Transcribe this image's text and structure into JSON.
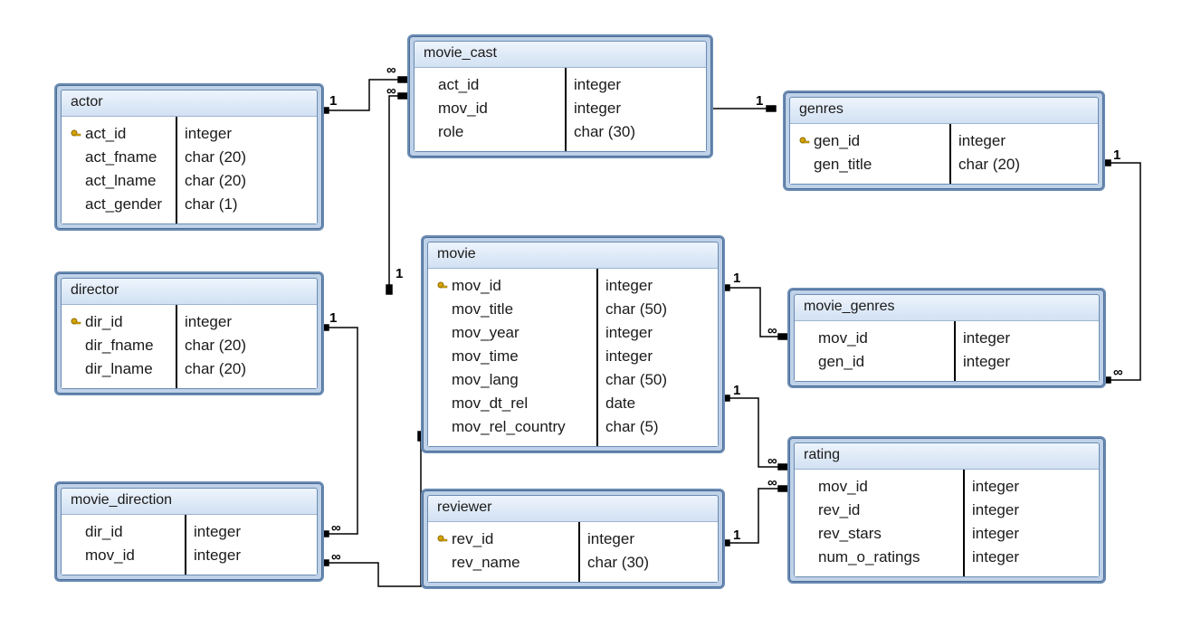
{
  "tables": {
    "actor": {
      "title": "actor",
      "columns": [
        {
          "name": "act_id",
          "type": "integer",
          "pk": true
        },
        {
          "name": "act_fname",
          "type": "char (20)",
          "pk": false
        },
        {
          "name": "act_lname",
          "type": "char (20)",
          "pk": false
        },
        {
          "name": "act_gender",
          "type": "char (1)",
          "pk": false
        }
      ]
    },
    "director": {
      "title": "director",
      "columns": [
        {
          "name": "dir_id",
          "type": "integer",
          "pk": true
        },
        {
          "name": "dir_fname",
          "type": "char (20)",
          "pk": false
        },
        {
          "name": "dir_lname",
          "type": "char (20)",
          "pk": false
        }
      ]
    },
    "movie_direction": {
      "title": "movie_direction",
      "columns": [
        {
          "name": "dir_id",
          "type": "integer",
          "pk": false
        },
        {
          "name": "mov_id",
          "type": "integer",
          "pk": false
        }
      ]
    },
    "movie_cast": {
      "title": "movie_cast",
      "columns": [
        {
          "name": "act_id",
          "type": "integer",
          "pk": false
        },
        {
          "name": "mov_id",
          "type": "integer",
          "pk": false
        },
        {
          "name": "role",
          "type": "char (30)",
          "pk": false
        }
      ]
    },
    "movie": {
      "title": "movie",
      "columns": [
        {
          "name": "mov_id",
          "type": "integer",
          "pk": true
        },
        {
          "name": "mov_title",
          "type": "char (50)",
          "pk": false
        },
        {
          "name": "mov_year",
          "type": "integer",
          "pk": false
        },
        {
          "name": "mov_time",
          "type": "integer",
          "pk": false
        },
        {
          "name": "mov_lang",
          "type": "char (50)",
          "pk": false
        },
        {
          "name": "mov_dt_rel",
          "type": "date",
          "pk": false
        },
        {
          "name": "mov_rel_country",
          "type": "char (5)",
          "pk": false
        }
      ]
    },
    "reviewer": {
      "title": "reviewer",
      "columns": [
        {
          "name": "rev_id",
          "type": "integer",
          "pk": true
        },
        {
          "name": "rev_name",
          "type": "char (30)",
          "pk": false
        }
      ]
    },
    "genres": {
      "title": "genres",
      "columns": [
        {
          "name": "gen_id",
          "type": "integer",
          "pk": true
        },
        {
          "name": "gen_title",
          "type": "char (20)",
          "pk": false
        }
      ]
    },
    "movie_genres": {
      "title": "movie_genres",
      "columns": [
        {
          "name": "mov_id",
          "type": "integer",
          "pk": false
        },
        {
          "name": "gen_id",
          "type": "integer",
          "pk": false
        }
      ]
    },
    "rating": {
      "title": "rating",
      "columns": [
        {
          "name": "mov_id",
          "type": "integer",
          "pk": false
        },
        {
          "name": "rev_id",
          "type": "integer",
          "pk": false
        },
        {
          "name": "rev_stars",
          "type": "integer",
          "pk": false
        },
        {
          "name": "num_o_ratings",
          "type": "integer",
          "pk": false
        }
      ]
    }
  },
  "relationships": [
    {
      "from": "actor",
      "to": "movie_cast",
      "card_from": "1",
      "card_to": "∞"
    },
    {
      "from": "movie",
      "to": "movie_cast",
      "card_from": "1",
      "card_to": "∞"
    },
    {
      "from": "director",
      "to": "movie_direction",
      "card_from": "1",
      "card_to": "∞"
    },
    {
      "from": "movie",
      "to": "movie_direction",
      "card_from": "1",
      "card_to": "∞"
    },
    {
      "from": "movie",
      "to": "movie_genres",
      "card_from": "1",
      "card_to": "∞"
    },
    {
      "from": "genres",
      "to": "movie_genres",
      "card_from": "1",
      "card_to": "∞"
    },
    {
      "from": "movie",
      "to": "rating",
      "card_from": "1",
      "card_to": "∞"
    },
    {
      "from": "reviewer",
      "to": "rating",
      "card_from": "1",
      "card_to": "∞"
    }
  ],
  "cardinality_symbols": {
    "one": "1",
    "many": "∞"
  },
  "chart_data": {
    "type": "er-diagram",
    "entities": [
      "actor",
      "director",
      "movie_direction",
      "movie_cast",
      "movie",
      "reviewer",
      "genres",
      "movie_genres",
      "rating"
    ],
    "relationships": [
      {
        "left": "actor",
        "right": "movie_cast",
        "cardinality": "1:∞"
      },
      {
        "left": "movie",
        "right": "movie_cast",
        "cardinality": "1:∞"
      },
      {
        "left": "director",
        "right": "movie_direction",
        "cardinality": "1:∞"
      },
      {
        "left": "movie",
        "right": "movie_direction",
        "cardinality": "1:∞"
      },
      {
        "left": "movie",
        "right": "movie_genres",
        "cardinality": "1:∞"
      },
      {
        "left": "genres",
        "right": "movie_genres",
        "cardinality": "1:∞"
      },
      {
        "left": "movie",
        "right": "rating",
        "cardinality": "1:∞"
      },
      {
        "left": "reviewer",
        "right": "rating",
        "cardinality": "1:∞"
      }
    ]
  }
}
